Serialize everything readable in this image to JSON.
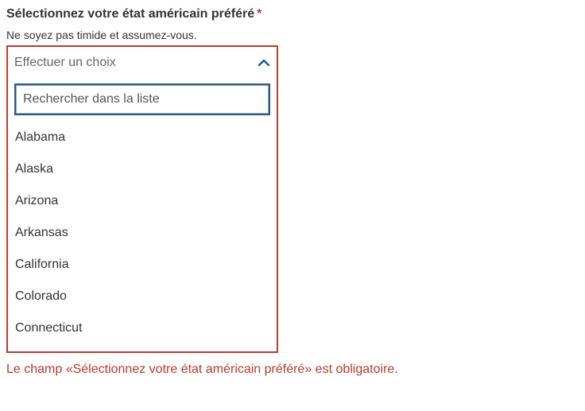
{
  "field": {
    "label": "Sélectionnez votre état américain préféré",
    "required_marker": "*",
    "hint": "Ne soyez pas timide et assumez-vous."
  },
  "select": {
    "placeholder": "Effectuer un choix",
    "expanded": true,
    "toggle_icon": "chevron-up-icon",
    "search": {
      "placeholder": "Rechercher dans la liste",
      "value": ""
    },
    "options": [
      {
        "label": "Alabama"
      },
      {
        "label": "Alaska"
      },
      {
        "label": "Arizona"
      },
      {
        "label": "Arkansas"
      },
      {
        "label": "California"
      },
      {
        "label": "Colorado"
      },
      {
        "label": "Connecticut"
      }
    ]
  },
  "error": {
    "message": "Le champ «Sélectionnez votre état américain préféré» est obligatoire."
  },
  "colors": {
    "error": "#c0392b",
    "focus": "#2b5a86",
    "chevron": "#1f5a8a",
    "text": "#333333"
  }
}
